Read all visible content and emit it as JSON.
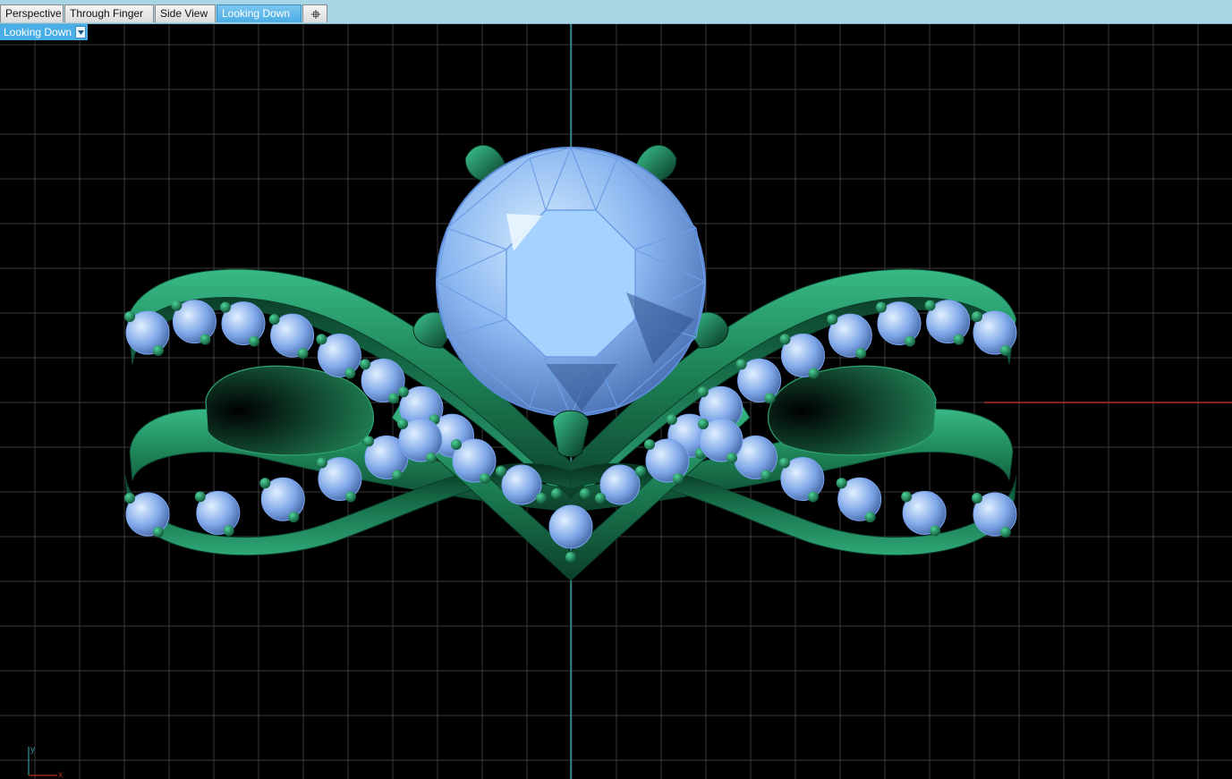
{
  "tabs": [
    {
      "label": "Perspective",
      "active": false
    },
    {
      "label": "Through Finger",
      "active": false
    },
    {
      "label": "Side View",
      "active": false
    },
    {
      "label": "Looking Down",
      "active": true
    }
  ],
  "add_tab_icon": "add-viewport-icon",
  "viewport": {
    "label": "Looking Down",
    "dropdown_icon": "chevron-down-icon"
  },
  "axes": {
    "x_label": "x",
    "y_label": "y"
  },
  "colors": {
    "grid": "#3c3c3c",
    "axis_x": "#b03020",
    "axis_y": "#2a9aa0",
    "metal": "#1f8a5c",
    "gem": "#8cb8f4",
    "tab_active": "#4aaee6"
  }
}
